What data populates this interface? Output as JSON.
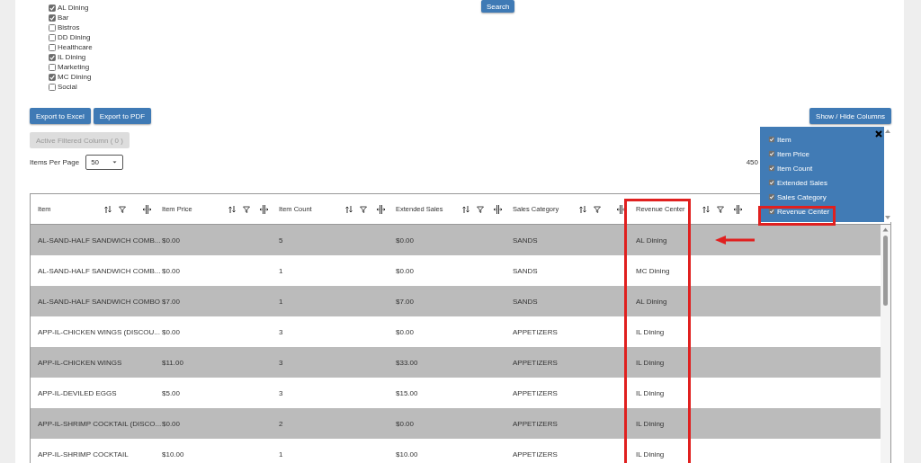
{
  "filters": {
    "revenue_centers": [
      {
        "label": "AL Dining",
        "checked": true
      },
      {
        "label": "Bar",
        "checked": true
      },
      {
        "label": "Bistros",
        "checked": false
      },
      {
        "label": "DD Dining",
        "checked": false
      },
      {
        "label": "Healthcare",
        "checked": false
      },
      {
        "label": "IL Dining",
        "checked": true
      },
      {
        "label": "Marketing",
        "checked": false
      },
      {
        "label": "MC Dining",
        "checked": true
      },
      {
        "label": "Social",
        "checked": false
      }
    ]
  },
  "search_button": "Search",
  "export_buttons": [
    "Export to Excel",
    "Export to PDF"
  ],
  "show_hide_button": "Show / Hide Columns",
  "active_filter_button": {
    "label": "Active Filtered Column ( 0 )",
    "disabled": true
  },
  "items_per_page": {
    "label": "Items Per Page",
    "value": "50"
  },
  "item_total": "450",
  "column_menu": {
    "expanded": true,
    "items": [
      {
        "label": "Item",
        "checked": true
      },
      {
        "label": "Item Price",
        "checked": true
      },
      {
        "label": "Item Count",
        "checked": true
      },
      {
        "label": "Extended Sales",
        "checked": true
      },
      {
        "label": "Sales Category",
        "checked": true
      },
      {
        "label": "Revenue Center",
        "checked": true
      }
    ]
  },
  "table": {
    "columns": [
      "Item",
      "Item Price",
      "Item Count",
      "Extended Sales",
      "Sales Category",
      "Revenue Center"
    ],
    "rows": [
      [
        "AL-SAND-HALF SANDWICH COMB...",
        "$0.00",
        "5",
        "$0.00",
        "SANDS",
        "AL Dining"
      ],
      [
        "AL-SAND-HALF SANDWICH COMB...",
        "$0.00",
        "1",
        "$0.00",
        "SANDS",
        "MC Dining"
      ],
      [
        "AL-SAND-HALF SANDWICH COMBO",
        "$7.00",
        "1",
        "$7.00",
        "SANDS",
        "AL Dining"
      ],
      [
        "APP-IL-CHICKEN WINGS (DISCOU...",
        "$0.00",
        "3",
        "$0.00",
        "APPETIZERS",
        "IL Dining"
      ],
      [
        "APP-IL-CHICKEN WINGS",
        "$11.00",
        "3",
        "$33.00",
        "APPETIZERS",
        "IL Dining"
      ],
      [
        "APP-IL-DEVILED EGGS",
        "$5.00",
        "3",
        "$15.00",
        "APPETIZERS",
        "IL Dining"
      ],
      [
        "APP-IL-SHRIMP COCKTAIL (DISCO...",
        "$0.00",
        "2",
        "$0.00",
        "APPETIZERS",
        "IL Dining"
      ],
      [
        "APP-IL-SHRIMP COCKTAIL",
        "$10.00",
        "1",
        "$10.00",
        "APPETIZERS",
        "IL Dining"
      ]
    ]
  },
  "annotations": [
    {
      "kind": "column-box"
    },
    {
      "kind": "menu-box"
    },
    {
      "kind": "arrow"
    }
  ]
}
